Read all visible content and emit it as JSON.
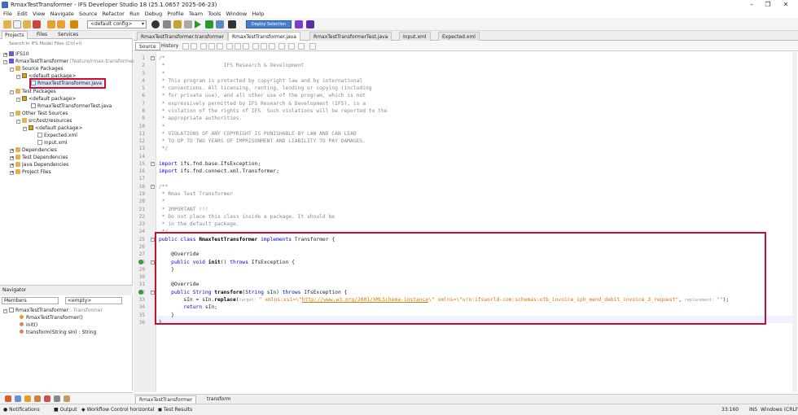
{
  "window": {
    "title": "RmaxTestTransformer - IFS Developer Studio 18 (25.1.0657 2025-06-23)",
    "minimize": "–",
    "maximize": "❐",
    "close": "✕"
  },
  "menu": [
    "File",
    "Edit",
    "View",
    "Navigate",
    "Source",
    "Refactor",
    "Run",
    "Debug",
    "Profile",
    "Team",
    "Tools",
    "Window",
    "Help"
  ],
  "toolbar": {
    "config": "<default config>",
    "config_arrow": "▾",
    "action_label": "Deploy Selection"
  },
  "projects_panel": {
    "tabs": [
      "Projects",
      "Files",
      "Services"
    ],
    "search_placeholder": "Search in IFS Model Files (Ctrl+I)",
    "tree": [
      {
        "label": "IFS10",
        "level": 0
      },
      {
        "label": "RmaxTestTransformer",
        "extra": "[feature/rmax-transformer-...",
        "level": 0
      },
      {
        "label": "Source Packages",
        "level": 1
      },
      {
        "label": "<default package>",
        "level": 2
      },
      {
        "label": "RmaxTestTransformer.java",
        "level": 3,
        "selected": true
      },
      {
        "label": "Test Packages",
        "level": 1
      },
      {
        "label": "<default package>",
        "level": 2
      },
      {
        "label": "RmaxTestTransformerTest.java",
        "level": 3
      },
      {
        "label": "Other Test Sources",
        "level": 1
      },
      {
        "label": "src/test/resources",
        "level": 2
      },
      {
        "label": "<default package>",
        "level": 3
      },
      {
        "label": "Expected.xml",
        "level": 4
      },
      {
        "label": "Input.xml",
        "level": 4
      },
      {
        "label": "Dependencies",
        "level": 1
      },
      {
        "label": "Test Dependencies",
        "level": 1
      },
      {
        "label": "Java Dependencies",
        "level": 1
      },
      {
        "label": "Project Files",
        "level": 1
      }
    ]
  },
  "navigator": {
    "title": "Navigator",
    "members": "Members",
    "filter": "<empty>",
    "root": "RmaxTestTransformer",
    "root_extends": ":: Transformer",
    "items": [
      {
        "label": "RmaxTestTransformer()"
      },
      {
        "label": "init()"
      },
      {
        "label": "transform(String sIn) : String"
      }
    ]
  },
  "editor_tabs": [
    "RmaxTestTransformer.transformer",
    "RmaxTestTransformer.java",
    "RmaxTestTransformerTest.java",
    "Input.xml",
    "Expected.xml"
  ],
  "editor_subtabs": [
    "Source",
    "History"
  ],
  "code": {
    "line_numbers": [
      "1",
      "2",
      "3",
      "4",
      "5",
      "6",
      "7",
      "8",
      "9",
      "10",
      "11",
      "12",
      "13",
      "14",
      "15",
      "16",
      "17",
      "18",
      "19",
      "20",
      "21",
      "22",
      "23",
      "24",
      "25",
      "26",
      "27",
      "28",
      "29",
      "30",
      "31",
      "32",
      "33",
      "34",
      "35",
      "36"
    ],
    "lines": [
      "/*",
      " *                   IFS Research & Development",
      " *",
      " * This program is protected by copyright law and by international",
      " * conventions. All licensing, renting, lending or copying (including",
      " * for private use), and all other use of the program, which is not",
      " * expressively permitted by IFS Research & Development (IFS), is a",
      " * violation of the rights of IFS. Such violations will be reported to the",
      " * appropriate authorities.",
      " *",
      " * VIOLATIONS OF ANY COPYRIGHT IS PUNISHABLE BY LAW AND CAN LEAD",
      " * TO UP TO TWO YEARS OF IMPRISONMENT AND LIABILITY TO PAY DAMAGES.",
      " */",
      "",
      "import ifs.fnd.base.IfsException;",
      "import ifs.fnd.connect.xml.Transformer;",
      "",
      "/**",
      " * Rmax Test Transformer",
      " *",
      " * IMPORTANT !!!",
      " * Do not place this class inside a package. It should be",
      " * in the default package.",
      " */",
      "public class RmaxTestTransformer implements Transformer {",
      "",
      "    @Override",
      "    public void init() throws IfsException {",
      "    }",
      "",
      "    @Override",
      "    public String transform(String sIn) throws IfsException {",
      "",
      "        return sIn;",
      "    }",
      "}"
    ],
    "line33": {
      "prefix": "        sIn = sIn.",
      "method": "replace",
      "open": "(",
      "hint_target": "target: ",
      "arg1a": "\" xmlns:xsi=\\\"",
      "arg1_url": "http://www.w3.org/2001/XMLSchema-instance",
      "arg1b": "\\\" xmlns=\\\"urn:ifsworld-com:schemas:otb_invoice_iph_mend_debit_invoice_3_request\"",
      "comma": ", ",
      "hint_repl": "replacement: ",
      "arg2": "\"\"",
      "close": ");"
    }
  },
  "bottom_tabs": [
    "RmaxTestTransformer",
    "transform"
  ],
  "status": {
    "notifications": "Notifications",
    "output": "Output",
    "workflow": "Workflow Control horizontal",
    "tests": "Test Results",
    "position": "33:160",
    "mode": "INS",
    "eol": "Windows (CRLF)"
  }
}
